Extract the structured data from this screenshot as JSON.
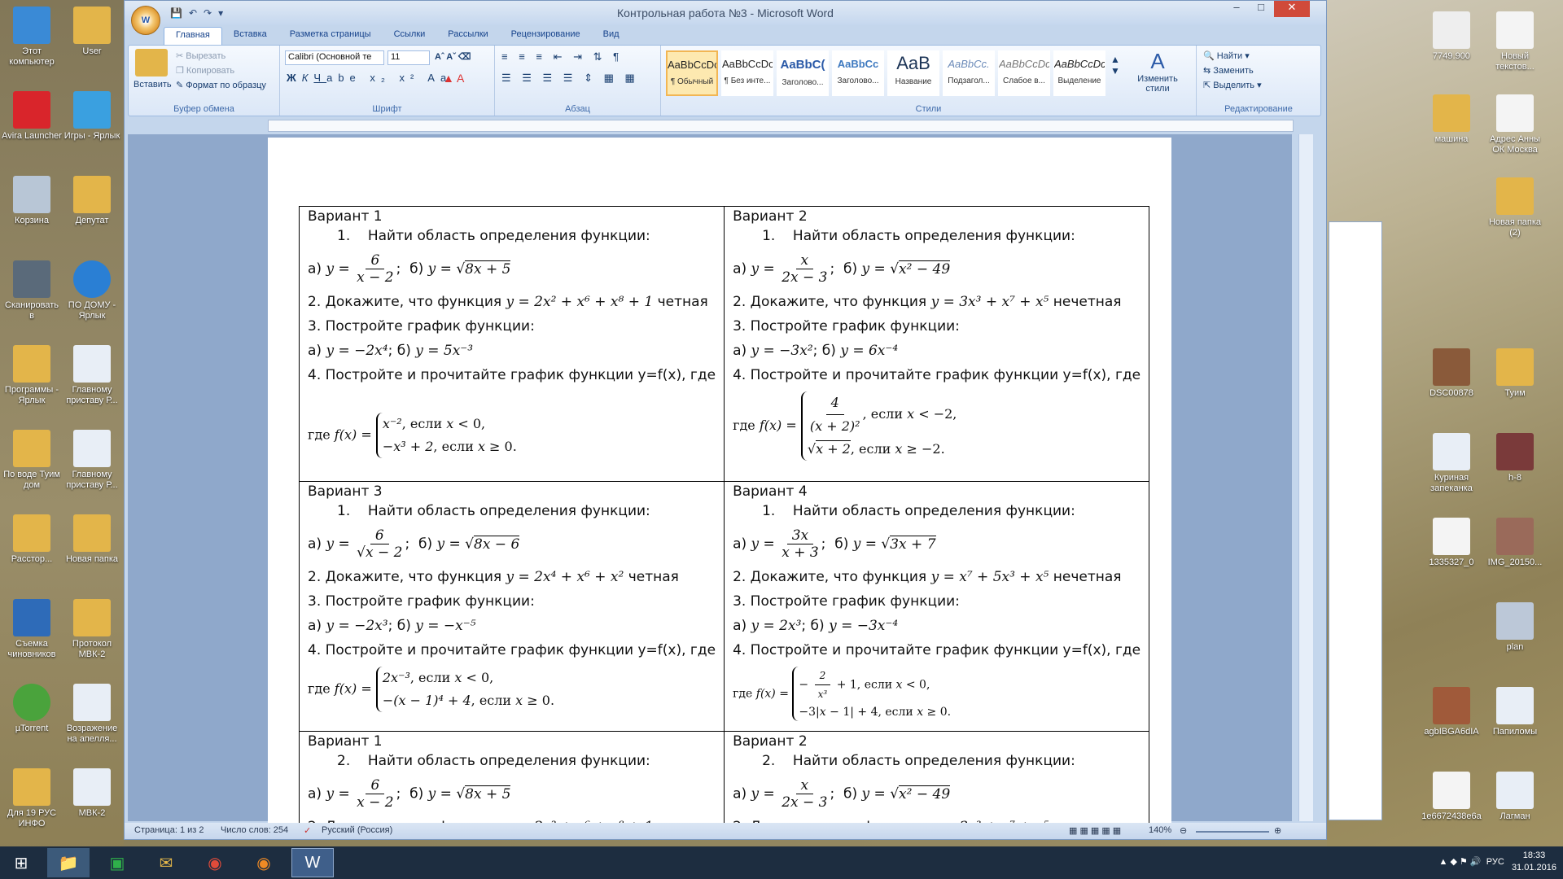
{
  "window": {
    "title": "Контрольная работа №3 - Microsoft Word"
  },
  "tabs": [
    "Главная",
    "Вставка",
    "Разметка страницы",
    "Ссылки",
    "Рассылки",
    "Рецензирование",
    "Вид"
  ],
  "clipboard": {
    "paste": "Вставить",
    "cut": "Вырезать",
    "copy": "Копировать",
    "format": "Формат по образцу",
    "label": "Буфер обмена"
  },
  "font": {
    "name": "Calibri (Основной те",
    "size": "11",
    "label": "Шрифт"
  },
  "paragraph": {
    "label": "Абзац"
  },
  "styles": {
    "items": [
      {
        "sample": "AaBbCcDc",
        "name": "¶ Обычный"
      },
      {
        "sample": "AaBbCcDc",
        "name": "¶ Без инте..."
      },
      {
        "sample": "AaBbC(",
        "name": "Заголово..."
      },
      {
        "sample": "AaBbCc",
        "name": "Заголово..."
      },
      {
        "sample": "AaB",
        "name": "Название"
      },
      {
        "sample": "AaBbCc.",
        "name": "Подзагол..."
      },
      {
        "sample": "AaBbCcDc",
        "name": "Слабое в..."
      },
      {
        "sample": "AaBbCcDc",
        "name": "Выделение"
      }
    ],
    "change": "Изменить стили",
    "label": "Стили"
  },
  "editing": {
    "find": "Найти",
    "replace": "Заменить",
    "select": "Выделить",
    "label": "Редактирование"
  },
  "doc": {
    "v1": "Вариант 1",
    "v2": "Вариант 2",
    "v3": "Вариант 3",
    "v4": "Вариант 4",
    "task1": "Найти область определения функции:",
    "prove": "2. Докажите, что функция",
    "even": "четная",
    "odd": "нечетная",
    "task3": "3. Постройте график функции:",
    "task4": "4. Постройте и прочитайте график функции y=f(x), где",
    "n1": "1.",
    "n2": "2."
  },
  "status": {
    "page": "Страница: 1 из 2",
    "words": "Число слов: 254",
    "lang": "Русский (Россия)",
    "zoom": "140%"
  },
  "desktop": {
    "left": [
      "Этот компьютер",
      "Avira Launcher",
      "Корзина",
      "Сканировать в",
      "Программы - Ярлык",
      "По воде Туим дом",
      "Расстор...",
      "Съемка чиновников",
      "µTorrent",
      "Для 19 РУС ИНФО"
    ],
    "left2": [
      "User",
      "Игры - Ярлык",
      "Депутат",
      "ПО ДОМУ - Ярлык",
      "Главному приставу Р...",
      "Главному приставу Р...",
      "Новая папка",
      "Протокол МВК-2",
      "Возражение на апелля...",
      "МВК-2"
    ],
    "right": [
      "7749.900",
      "Новый текстов...",
      "машина",
      "Адрес Анны ОК Москва",
      "Новая папка (2)",
      "DSC00878",
      "Туим",
      "Куриная запеканка",
      "h-8",
      "1335327_0",
      "IMG_20150...",
      "plan",
      "agbIBGA6dIA",
      "Папиломы",
      "1e6672438e6a",
      "Лагман"
    ]
  },
  "tray": {
    "lang": "РУС",
    "time": "18:33",
    "date": "31.01.2016"
  }
}
